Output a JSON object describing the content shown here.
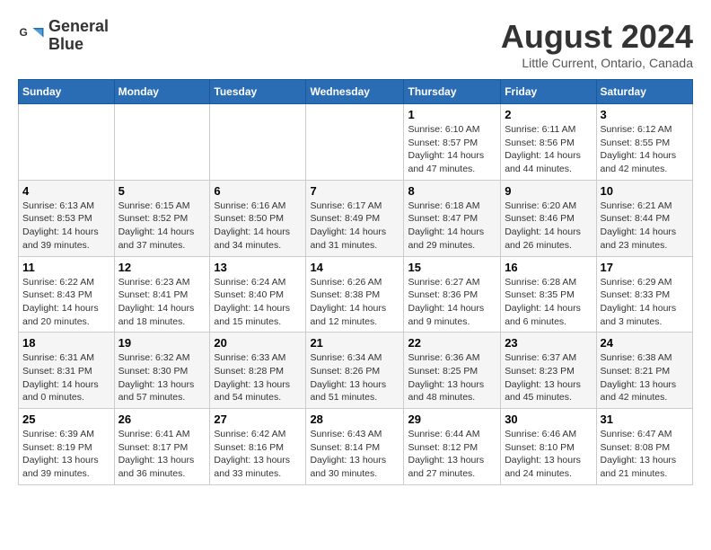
{
  "logo": {
    "line1": "General",
    "line2": "Blue"
  },
  "title": "August 2024",
  "subtitle": "Little Current, Ontario, Canada",
  "days_of_week": [
    "Sunday",
    "Monday",
    "Tuesday",
    "Wednesday",
    "Thursday",
    "Friday",
    "Saturday"
  ],
  "weeks": [
    [
      {
        "day": "",
        "info": ""
      },
      {
        "day": "",
        "info": ""
      },
      {
        "day": "",
        "info": ""
      },
      {
        "day": "",
        "info": ""
      },
      {
        "day": "1",
        "info": "Sunrise: 6:10 AM\nSunset: 8:57 PM\nDaylight: 14 hours and 47 minutes."
      },
      {
        "day": "2",
        "info": "Sunrise: 6:11 AM\nSunset: 8:56 PM\nDaylight: 14 hours and 44 minutes."
      },
      {
        "day": "3",
        "info": "Sunrise: 6:12 AM\nSunset: 8:55 PM\nDaylight: 14 hours and 42 minutes."
      }
    ],
    [
      {
        "day": "4",
        "info": "Sunrise: 6:13 AM\nSunset: 8:53 PM\nDaylight: 14 hours and 39 minutes."
      },
      {
        "day": "5",
        "info": "Sunrise: 6:15 AM\nSunset: 8:52 PM\nDaylight: 14 hours and 37 minutes."
      },
      {
        "day": "6",
        "info": "Sunrise: 6:16 AM\nSunset: 8:50 PM\nDaylight: 14 hours and 34 minutes."
      },
      {
        "day": "7",
        "info": "Sunrise: 6:17 AM\nSunset: 8:49 PM\nDaylight: 14 hours and 31 minutes."
      },
      {
        "day": "8",
        "info": "Sunrise: 6:18 AM\nSunset: 8:47 PM\nDaylight: 14 hours and 29 minutes."
      },
      {
        "day": "9",
        "info": "Sunrise: 6:20 AM\nSunset: 8:46 PM\nDaylight: 14 hours and 26 minutes."
      },
      {
        "day": "10",
        "info": "Sunrise: 6:21 AM\nSunset: 8:44 PM\nDaylight: 14 hours and 23 minutes."
      }
    ],
    [
      {
        "day": "11",
        "info": "Sunrise: 6:22 AM\nSunset: 8:43 PM\nDaylight: 14 hours and 20 minutes."
      },
      {
        "day": "12",
        "info": "Sunrise: 6:23 AM\nSunset: 8:41 PM\nDaylight: 14 hours and 18 minutes."
      },
      {
        "day": "13",
        "info": "Sunrise: 6:24 AM\nSunset: 8:40 PM\nDaylight: 14 hours and 15 minutes."
      },
      {
        "day": "14",
        "info": "Sunrise: 6:26 AM\nSunset: 8:38 PM\nDaylight: 14 hours and 12 minutes."
      },
      {
        "day": "15",
        "info": "Sunrise: 6:27 AM\nSunset: 8:36 PM\nDaylight: 14 hours and 9 minutes."
      },
      {
        "day": "16",
        "info": "Sunrise: 6:28 AM\nSunset: 8:35 PM\nDaylight: 14 hours and 6 minutes."
      },
      {
        "day": "17",
        "info": "Sunrise: 6:29 AM\nSunset: 8:33 PM\nDaylight: 14 hours and 3 minutes."
      }
    ],
    [
      {
        "day": "18",
        "info": "Sunrise: 6:31 AM\nSunset: 8:31 PM\nDaylight: 14 hours and 0 minutes."
      },
      {
        "day": "19",
        "info": "Sunrise: 6:32 AM\nSunset: 8:30 PM\nDaylight: 13 hours and 57 minutes."
      },
      {
        "day": "20",
        "info": "Sunrise: 6:33 AM\nSunset: 8:28 PM\nDaylight: 13 hours and 54 minutes."
      },
      {
        "day": "21",
        "info": "Sunrise: 6:34 AM\nSunset: 8:26 PM\nDaylight: 13 hours and 51 minutes."
      },
      {
        "day": "22",
        "info": "Sunrise: 6:36 AM\nSunset: 8:25 PM\nDaylight: 13 hours and 48 minutes."
      },
      {
        "day": "23",
        "info": "Sunrise: 6:37 AM\nSunset: 8:23 PM\nDaylight: 13 hours and 45 minutes."
      },
      {
        "day": "24",
        "info": "Sunrise: 6:38 AM\nSunset: 8:21 PM\nDaylight: 13 hours and 42 minutes."
      }
    ],
    [
      {
        "day": "25",
        "info": "Sunrise: 6:39 AM\nSunset: 8:19 PM\nDaylight: 13 hours and 39 minutes."
      },
      {
        "day": "26",
        "info": "Sunrise: 6:41 AM\nSunset: 8:17 PM\nDaylight: 13 hours and 36 minutes."
      },
      {
        "day": "27",
        "info": "Sunrise: 6:42 AM\nSunset: 8:16 PM\nDaylight: 13 hours and 33 minutes."
      },
      {
        "day": "28",
        "info": "Sunrise: 6:43 AM\nSunset: 8:14 PM\nDaylight: 13 hours and 30 minutes."
      },
      {
        "day": "29",
        "info": "Sunrise: 6:44 AM\nSunset: 8:12 PM\nDaylight: 13 hours and 27 minutes."
      },
      {
        "day": "30",
        "info": "Sunrise: 6:46 AM\nSunset: 8:10 PM\nDaylight: 13 hours and 24 minutes."
      },
      {
        "day": "31",
        "info": "Sunrise: 6:47 AM\nSunset: 8:08 PM\nDaylight: 13 hours and 21 minutes."
      }
    ]
  ]
}
